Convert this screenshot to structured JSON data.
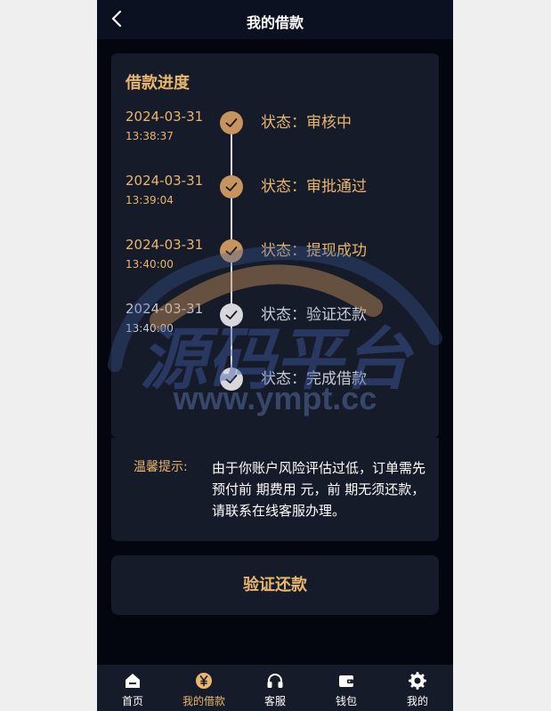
{
  "header": {
    "title": "我的借款"
  },
  "progress": {
    "title": "借款进度",
    "steps": [
      {
        "date": "2024-03-31",
        "time": "13:38:37",
        "status": "状态：审核中",
        "done": true
      },
      {
        "date": "2024-03-31",
        "time": "13:39:04",
        "status": "状态：审批通过",
        "done": true
      },
      {
        "date": "2024-03-31",
        "time": "13:40:00",
        "status": "状态：提现成功",
        "done": true
      },
      {
        "date": "2024-03-31",
        "time": "13:40:00",
        "status": "状态：验证还款",
        "done": false
      },
      {
        "date": "",
        "time": "",
        "status": "状态：完成借款",
        "done": false
      }
    ]
  },
  "tip": {
    "label": "温馨提示:",
    "text": "由于你账户风险评估过低，订单需先预付前 期费用 元，前 期无须还款，请联系在线客服办理。"
  },
  "action": {
    "verify_label": "验证还款"
  },
  "watermark": {
    "text": "源码平台",
    "url": "www.ympt.cc"
  },
  "tabs": [
    {
      "label": "首页",
      "icon": "home-icon",
      "active": false
    },
    {
      "label": "我的借款",
      "icon": "yen-icon",
      "active": true
    },
    {
      "label": "客服",
      "icon": "headset-icon",
      "active": false
    },
    {
      "label": "钱包",
      "icon": "wallet-icon",
      "active": false
    },
    {
      "label": "我的",
      "icon": "gear-icon",
      "active": false
    }
  ],
  "colors": {
    "accent": "#e8b66c",
    "card": "#161b29",
    "background": "#03060e",
    "done_dot": "#c8945e",
    "pending_dot": "#d7d7dc"
  }
}
